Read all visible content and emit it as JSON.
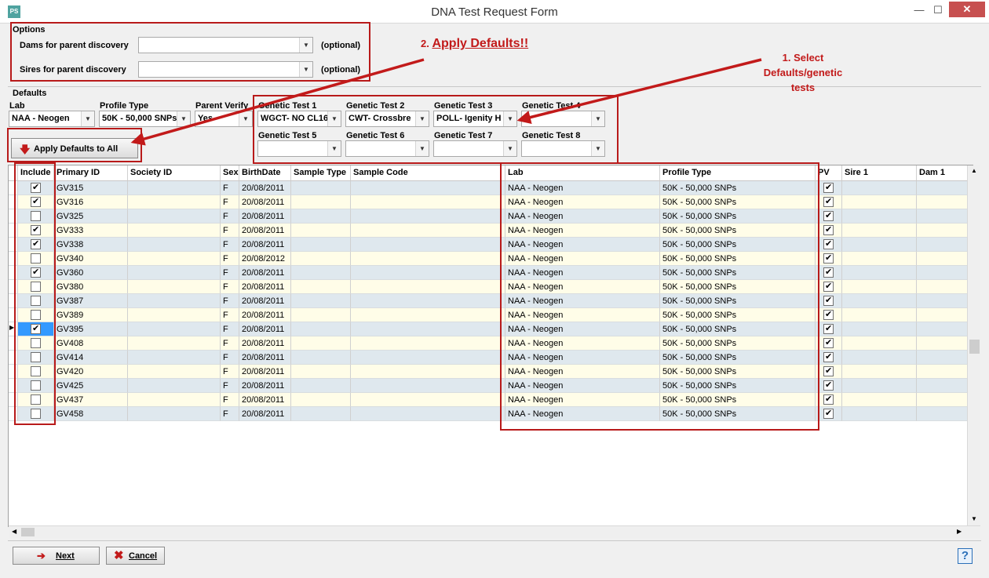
{
  "window": {
    "title": "DNA Test Request Form",
    "app_icon_text": "PS",
    "minimize": "—",
    "maximize": "☐",
    "close": "✕"
  },
  "options": {
    "group_label": "Options",
    "dams_label": "Dams for parent discovery",
    "dams_value": "",
    "dams_note": "(optional)",
    "sires_label": "Sires for parent discovery",
    "sires_value": "",
    "sires_note": "(optional)"
  },
  "defaults": {
    "group_label": "Defaults",
    "lab_label": "Lab",
    "lab_value": "NAA - Neogen",
    "profile_label": "Profile Type",
    "profile_value": "50K - 50,000 SNPs",
    "parent_verify_label": "Parent Verify",
    "parent_verify_value": "Yes",
    "apply_button": "Apply Defaults to All",
    "tests": [
      {
        "label": "Genetic Test 1",
        "value": "WGCT- NO CL16"
      },
      {
        "label": "Genetic Test 2",
        "value": "CWT- Crossbre"
      },
      {
        "label": "Genetic Test 3",
        "value": "POLL- Igenity H"
      },
      {
        "label": "Genetic Test 4",
        "value": ""
      },
      {
        "label": "Genetic Test 5",
        "value": ""
      },
      {
        "label": "Genetic Test 6",
        "value": ""
      },
      {
        "label": "Genetic Test 7",
        "value": ""
      },
      {
        "label": "Genetic Test 8",
        "value": ""
      }
    ]
  },
  "annotations": {
    "step1": "1. Select Defaults/genetic tests",
    "step2_prefix": "2. ",
    "step2_link": "Apply Defaults!!"
  },
  "grid": {
    "columns": [
      "Include",
      "Primary ID",
      "Society ID",
      "Sex",
      "BirthDate",
      "Sample Type",
      "Sample Code",
      "Lab",
      "Profile Type",
      "PV",
      "Sire 1",
      "Dam 1"
    ],
    "current_row_marker": "▶",
    "rows": [
      {
        "include": true,
        "id": "GV315",
        "sex": "F",
        "birth": "20/08/2011",
        "lab": "NAA - Neogen",
        "profile": "50K - 50,000 SNPs",
        "pv": true
      },
      {
        "include": true,
        "id": "GV316",
        "sex": "F",
        "birth": "20/08/2011",
        "lab": "NAA - Neogen",
        "profile": "50K - 50,000 SNPs",
        "pv": true
      },
      {
        "include": false,
        "id": "GV325",
        "sex": "F",
        "birth": "20/08/2011",
        "lab": "NAA - Neogen",
        "profile": "50K - 50,000 SNPs",
        "pv": true
      },
      {
        "include": true,
        "id": "GV333",
        "sex": "F",
        "birth": "20/08/2011",
        "lab": "NAA - Neogen",
        "profile": "50K - 50,000 SNPs",
        "pv": true
      },
      {
        "include": true,
        "id": "GV338",
        "sex": "F",
        "birth": "20/08/2011",
        "lab": "NAA - Neogen",
        "profile": "50K - 50,000 SNPs",
        "pv": true
      },
      {
        "include": false,
        "id": "GV340",
        "sex": "F",
        "birth": "20/08/2012",
        "lab": "NAA - Neogen",
        "profile": "50K - 50,000 SNPs",
        "pv": true
      },
      {
        "include": true,
        "id": "GV360",
        "sex": "F",
        "birth": "20/08/2011",
        "lab": "NAA - Neogen",
        "profile": "50K - 50,000 SNPs",
        "pv": true
      },
      {
        "include": false,
        "id": "GV380",
        "sex": "F",
        "birth": "20/08/2011",
        "lab": "NAA - Neogen",
        "profile": "50K - 50,000 SNPs",
        "pv": true
      },
      {
        "include": false,
        "id": "GV387",
        "sex": "F",
        "birth": "20/08/2011",
        "lab": "NAA - Neogen",
        "profile": "50K - 50,000 SNPs",
        "pv": true
      },
      {
        "include": false,
        "id": "GV389",
        "sex": "F",
        "birth": "20/08/2011",
        "lab": "NAA - Neogen",
        "profile": "50K - 50,000 SNPs",
        "pv": true
      },
      {
        "include": true,
        "id": "GV395",
        "sex": "F",
        "birth": "20/08/2011",
        "lab": "NAA - Neogen",
        "profile": "50K - 50,000 SNPs",
        "pv": true,
        "current": true
      },
      {
        "include": false,
        "id": "GV408",
        "sex": "F",
        "birth": "20/08/2011",
        "lab": "NAA - Neogen",
        "profile": "50K - 50,000 SNPs",
        "pv": true
      },
      {
        "include": false,
        "id": "GV414",
        "sex": "F",
        "birth": "20/08/2011",
        "lab": "NAA - Neogen",
        "profile": "50K - 50,000 SNPs",
        "pv": true
      },
      {
        "include": false,
        "id": "GV420",
        "sex": "F",
        "birth": "20/08/2011",
        "lab": "NAA - Neogen",
        "profile": "50K - 50,000 SNPs",
        "pv": true
      },
      {
        "include": false,
        "id": "GV425",
        "sex": "F",
        "birth": "20/08/2011",
        "lab": "NAA - Neogen",
        "profile": "50K - 50,000 SNPs",
        "pv": true
      },
      {
        "include": false,
        "id": "GV437",
        "sex": "F",
        "birth": "20/08/2011",
        "lab": "NAA - Neogen",
        "profile": "50K - 50,000 SNPs",
        "pv": true
      },
      {
        "include": false,
        "id": "GV458",
        "sex": "F",
        "birth": "20/08/2011",
        "lab": "NAA - Neogen",
        "profile": "50K - 50,000 SNPs",
        "pv": true
      }
    ]
  },
  "footer": {
    "next_label": "Next",
    "cancel_label": "Cancel",
    "help_label": "?"
  },
  "colors": {
    "annotation_red": "#c21a1a",
    "row_even": "#dfe8ee",
    "row_odd": "#fffde8",
    "close_button": "#c75050"
  }
}
